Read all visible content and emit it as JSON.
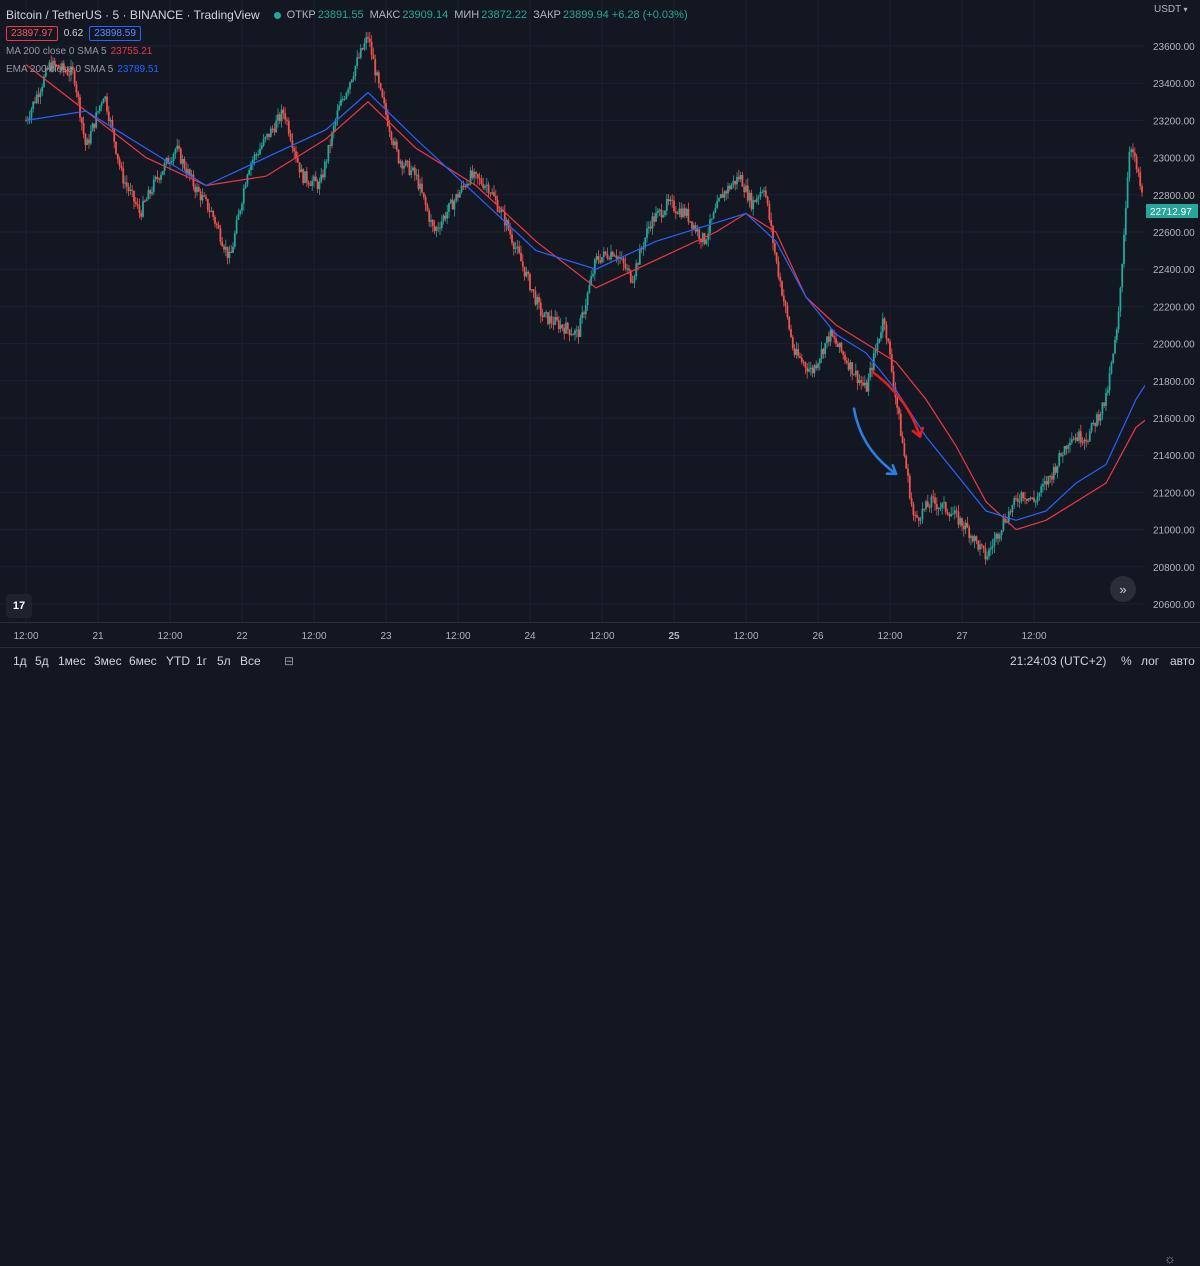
{
  "header": {
    "symbol": "Bitcoin / TetherUS · 5 · BINANCE · TradingView",
    "ohlc": [
      {
        "key": "ОТКР",
        "value": "23891.55"
      },
      {
        "key": "МАКС",
        "value": "23909.14"
      },
      {
        "key": "МИН",
        "value": "23872.22"
      },
      {
        "key": "ЗАКР",
        "value": "23899.94 +6.28 (+0.03%)"
      }
    ],
    "sell_price": "23897.97",
    "spread": "0.62",
    "buy_price": "23898.59"
  },
  "indicators": [
    {
      "name": "MA 200 close 0 SMA 5",
      "value": "23755.21",
      "color": "#f23645"
    },
    {
      "name": "EMA 200 close 0 SMA 5",
      "value": "23789.51",
      "color": "#2962ff"
    }
  ],
  "price_scale": {
    "currency": "USDT",
    "current_label": "22712.97"
  },
  "time_axis": {
    "labels": [
      "12:00",
      "21",
      "12:00",
      "22",
      "12:00",
      "23",
      "12:00",
      "24",
      "12:00",
      "25",
      "12:00",
      "26",
      "12:00",
      "27",
      "12:00"
    ]
  },
  "bottom_bar": {
    "ranges": [
      "1д",
      "5д",
      "1мес",
      "3мес",
      "6мес",
      "YTD",
      "1г",
      "5л",
      "Все"
    ],
    "clock": "21:24:03 (UTC+2)",
    "percent": "%",
    "log": "лог",
    "auto": "авто"
  },
  "icons": {
    "logo": "tradingview-logo-icon",
    "scroll": "scroll-to-realtime-icon",
    "settings": "gear-icon",
    "compare": "compare-icon"
  },
  "colors": {
    "background": "#131722",
    "up": "#26a69a",
    "down": "#ef5350",
    "ma": "#f23645",
    "ema": "#2962ff",
    "annotation_red": "#e02020",
    "annotation_blue": "#2a7fe0"
  },
  "chart_data": {
    "type": "candlestick",
    "title": "Bitcoin / TetherUS · 5 · BINANCE",
    "ylim": [
      20500,
      23800
    ],
    "y_ticks": [
      20600,
      20800,
      21000,
      21200,
      21400,
      21600,
      21800,
      22000,
      22200,
      22400,
      22600,
      22800,
      23000,
      23200,
      23400,
      23600
    ],
    "current_price": 22712.97,
    "x_range_hours": [
      0,
      174
    ],
    "price_path": [
      [
        0,
        23200
      ],
      [
        4,
        23500
      ],
      [
        8,
        23450
      ],
      [
        10,
        23050
      ],
      [
        13,
        23350
      ],
      [
        16,
        22900
      ],
      [
        19,
        22700
      ],
      [
        22,
        22900
      ],
      [
        25,
        23050
      ],
      [
        28,
        22850
      ],
      [
        31,
        22700
      ],
      [
        34,
        22450
      ],
      [
        37,
        22950
      ],
      [
        40,
        23100
      ],
      [
        43,
        23250
      ],
      [
        46,
        22900
      ],
      [
        49,
        22850
      ],
      [
        52,
        23250
      ],
      [
        55,
        23500
      ],
      [
        57,
        23650
      ],
      [
        59,
        23350
      ],
      [
        62,
        23000
      ],
      [
        65,
        22900
      ],
      [
        68,
        22600
      ],
      [
        71,
        22750
      ],
      [
        74,
        22900
      ],
      [
        77,
        22850
      ],
      [
        80,
        22650
      ],
      [
        83,
        22400
      ],
      [
        86,
        22150
      ],
      [
        89,
        22100
      ],
      [
        92,
        22050
      ],
      [
        95,
        22450
      ],
      [
        98,
        22500
      ],
      [
        101,
        22350
      ],
      [
        104,
        22650
      ],
      [
        107,
        22750
      ],
      [
        110,
        22700
      ],
      [
        113,
        22550
      ],
      [
        116,
        22800
      ],
      [
        119,
        22900
      ],
      [
        121,
        22750
      ],
      [
        123,
        22850
      ],
      [
        125,
        22450
      ],
      [
        128,
        21950
      ],
      [
        131,
        21850
      ],
      [
        134,
        22050
      ],
      [
        137,
        21900
      ],
      [
        140,
        21750
      ],
      [
        143,
        22150
      ],
      [
        145,
        21700
      ],
      [
        148,
        21050
      ],
      [
        151,
        21150
      ],
      [
        154,
        21100
      ],
      [
        157,
        21000
      ],
      [
        160,
        20850
      ],
      [
        163,
        21050
      ],
      [
        166,
        21200
      ],
      [
        168,
        21150
      ],
      [
        171,
        21300
      ],
      [
        174,
        21500
      ],
      [
        177,
        21500
      ],
      [
        180,
        21700
      ],
      [
        182,
        22100
      ],
      [
        184,
        23100
      ],
      [
        186,
        22800
      ],
      [
        187,
        22713
      ]
    ],
    "series": [
      {
        "name": "MA 200 close 0 SMA 5",
        "color": "#f23645",
        "points": [
          [
            0,
            23500
          ],
          [
            10,
            23250
          ],
          [
            20,
            23000
          ],
          [
            30,
            22850
          ],
          [
            40,
            22900
          ],
          [
            50,
            23100
          ],
          [
            57,
            23300
          ],
          [
            65,
            23050
          ],
          [
            75,
            22850
          ],
          [
            85,
            22550
          ],
          [
            95,
            22300
          ],
          [
            105,
            22450
          ],
          [
            115,
            22600
          ],
          [
            120,
            22700
          ],
          [
            125,
            22600
          ],
          [
            130,
            22250
          ],
          [
            135,
            22100
          ],
          [
            140,
            22000
          ],
          [
            145,
            21900
          ],
          [
            150,
            21700
          ],
          [
            155,
            21450
          ],
          [
            160,
            21150
          ],
          [
            165,
            21000
          ],
          [
            170,
            21050
          ],
          [
            175,
            21150
          ],
          [
            180,
            21250
          ],
          [
            185,
            21550
          ],
          [
            187,
            21600
          ]
        ]
      },
      {
        "name": "EMA 200 close 0 SMA 5",
        "color": "#2962ff",
        "points": [
          [
            0,
            23200
          ],
          [
            10,
            23250
          ],
          [
            20,
            23050
          ],
          [
            30,
            22850
          ],
          [
            40,
            23000
          ],
          [
            50,
            23150
          ],
          [
            57,
            23350
          ],
          [
            65,
            23100
          ],
          [
            75,
            22800
          ],
          [
            85,
            22500
          ],
          [
            95,
            22400
          ],
          [
            105,
            22550
          ],
          [
            115,
            22650
          ],
          [
            120,
            22700
          ],
          [
            125,
            22550
          ],
          [
            130,
            22250
          ],
          [
            135,
            22050
          ],
          [
            140,
            21950
          ],
          [
            145,
            21750
          ],
          [
            150,
            21500
          ],
          [
            155,
            21300
          ],
          [
            160,
            21100
          ],
          [
            165,
            21050
          ],
          [
            170,
            21100
          ],
          [
            175,
            21250
          ],
          [
            180,
            21350
          ],
          [
            185,
            21700
          ],
          [
            187,
            21800
          ]
        ]
      }
    ],
    "annotations": [
      {
        "type": "arrow",
        "color": "#e02020",
        "from": [
          141,
          21850
        ],
        "to": [
          149,
          21500
        ]
      },
      {
        "type": "arrow",
        "color": "#2a7fe0",
        "from": [
          138,
          21650
        ],
        "to": [
          145,
          21300
        ]
      }
    ]
  }
}
